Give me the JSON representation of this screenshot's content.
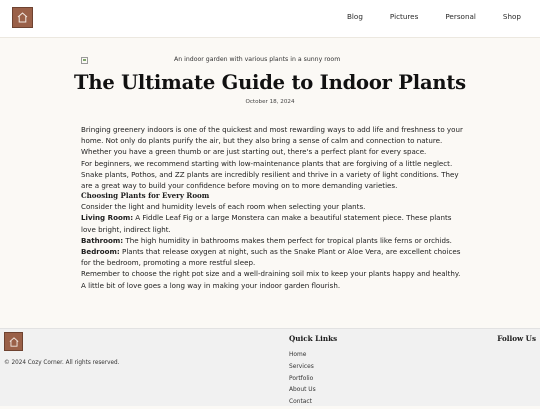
{
  "header": {
    "nav": [
      "Blog",
      "Pictures",
      "Personal",
      "Shop"
    ]
  },
  "article": {
    "image_alt": "An indoor garden with various plants in a sunny room",
    "title": "The Ultimate Guide to Indoor Plants",
    "date": "October 18, 2024",
    "intro": "Bringing greenery indoors is one of the quickest and most rewarding ways to add life and freshness to your home. Not only do plants purify the air, but they also bring a sense of calm and connection to nature. Whether you have a green thumb or are just starting out, there's a perfect plant for every space.",
    "beginners": "For beginners, we recommend starting with low-maintenance plants that are forgiving of a little neglect. Snake plants, Pothos, and ZZ plants are incredibly resilient and thrive in a variety of light conditions. They are a great way to build your confidence before moving on to more demanding varieties.",
    "subheading": "Choosing Plants for Every Room",
    "consider": "Consider the light and humidity levels of each room when selecting your plants.",
    "rooms": [
      {
        "label": "Living Room:",
        "text": " A Fiddle Leaf Fig or a large Monstera can make a beautiful statement piece. These plants love bright, indirect light."
      },
      {
        "label": "Bathroom:",
        "text": " The high humidity in bathrooms makes them perfect for tropical plants like ferns or orchids."
      },
      {
        "label": "Bedroom:",
        "text": " Plants that release oxygen at night, such as the Snake Plant or Aloe Vera, are excellent choices for the bedroom, promoting a more restful sleep."
      }
    ],
    "closing": "Remember to choose the right pot size and a well-draining soil mix to keep your plants happy and healthy. A little bit of love goes a long way in making your indoor garden flourish."
  },
  "footer": {
    "copyright": "© 2024 Cozy Corner. All rights reserved.",
    "quick_links_title": "Quick Links",
    "quick_links": [
      "Home",
      "Services",
      "Portfolio",
      "About Us",
      "Contact"
    ],
    "follow_title": "Follow Us"
  },
  "colors": {
    "logo_bg": "#9a6048",
    "page_bg": "#fbf9f5",
    "footer_bg": "#f1f1f1"
  }
}
